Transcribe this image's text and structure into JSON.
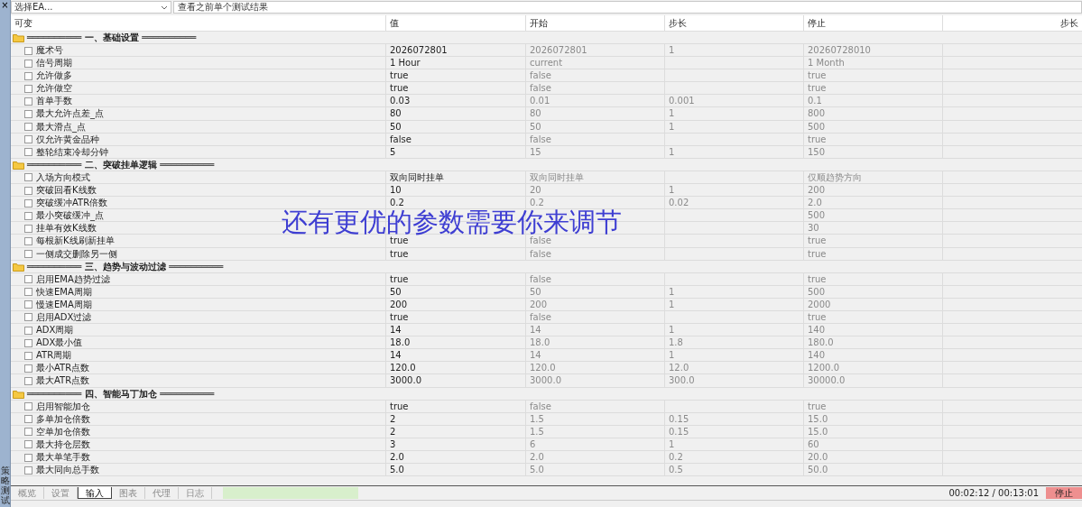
{
  "ea_selector": {
    "value": "选择EA..."
  },
  "history_field": {
    "value": "查看之前单个测试结果"
  },
  "columns": [
    "可变",
    "值",
    "开始",
    "步长",
    "停止",
    "步长"
  ],
  "groups": [
    {
      "title": "══════════ 一、基础设置 ══════════",
      "rows": [
        {
          "name": "魔术号",
          "checked": false,
          "value": "2026072801",
          "start": "2026072801",
          "step": "1",
          "stop": "20260728010"
        },
        {
          "name": "信号周期",
          "checked": false,
          "value": "1 Hour",
          "start": "current",
          "stop": "1 Month"
        },
        {
          "name": "允许做多",
          "checked": false,
          "value": "true",
          "start": "false",
          "stop": "true"
        },
        {
          "name": "允许做空",
          "checked": false,
          "value": "true",
          "start": "false",
          "stop": "true"
        },
        {
          "name": "首单手数",
          "checked": false,
          "value": "0.03",
          "start": "0.01",
          "step": "0.001",
          "stop": "0.1"
        },
        {
          "name": "最大允许点差_点",
          "checked": false,
          "value": "80",
          "start": "80",
          "step": "1",
          "stop": "800"
        },
        {
          "name": "最大滑点_点",
          "checked": false,
          "value": "50",
          "start": "50",
          "step": "1",
          "stop": "500"
        },
        {
          "name": "仅允许黄金品种",
          "checked": false,
          "value": "false",
          "start": "false",
          "stop": "true"
        },
        {
          "name": "整轮结束冷却分钟",
          "checked": false,
          "value": "5",
          "start": "15",
          "step": "1",
          "stop": "150"
        }
      ]
    },
    {
      "title": "══════════ 二、突破挂单逻辑 ══════════",
      "rows": [
        {
          "name": "入场方向模式",
          "checked": false,
          "value": "双向同时挂单",
          "start": "双向同时挂单",
          "stop": "仅顺趋势方向"
        },
        {
          "name": "突破回看K线数",
          "checked": false,
          "value": "10",
          "start": "20",
          "step": "1",
          "stop": "200"
        },
        {
          "name": "突破缓冲ATR倍数",
          "checked": false,
          "value": "0.2",
          "start": "0.2",
          "step": "0.02",
          "stop": "2.0"
        },
        {
          "name": "最小突破缓冲_点",
          "checked": false,
          "stop": "500"
        },
        {
          "name": "挂单有效K线数",
          "checked": false,
          "stop": "30"
        },
        {
          "name": "每根新K线刷新挂单",
          "checked": false,
          "value": "true",
          "start": "false",
          "stop": "true"
        },
        {
          "name": "一侧成交删除另一侧",
          "checked": false,
          "value": "true",
          "start": "false",
          "stop": "true"
        }
      ]
    },
    {
      "title": "══════════ 三、趋势与波动过滤 ══════════",
      "rows": [
        {
          "name": "启用EMA趋势过滤",
          "checked": false,
          "value": "true",
          "start": "false",
          "stop": "true"
        },
        {
          "name": "快速EMA周期",
          "checked": false,
          "value": "50",
          "start": "50",
          "step": "1",
          "stop": "500"
        },
        {
          "name": "慢速EMA周期",
          "checked": false,
          "value": "200",
          "start": "200",
          "step": "1",
          "stop": "2000"
        },
        {
          "name": "启用ADX过滤",
          "checked": false,
          "value": "true",
          "start": "false",
          "stop": "true"
        },
        {
          "name": "ADX周期",
          "checked": false,
          "value": "14",
          "start": "14",
          "step": "1",
          "stop": "140"
        },
        {
          "name": "ADX最小值",
          "checked": false,
          "value": "18.0",
          "start": "18.0",
          "step": "1.8",
          "stop": "180.0"
        },
        {
          "name": "ATR周期",
          "checked": false,
          "value": "14",
          "start": "14",
          "step": "1",
          "stop": "140"
        },
        {
          "name": "最小ATR点数",
          "checked": false,
          "value": "120.0",
          "start": "120.0",
          "step": "12.0",
          "stop": "1200.0"
        },
        {
          "name": "最大ATR点数",
          "checked": false,
          "value": "3000.0",
          "start": "3000.0",
          "step": "300.0",
          "stop": "30000.0"
        }
      ]
    },
    {
      "title": "══════════ 四、智能马丁加仓 ══════════",
      "rows": [
        {
          "name": "启用智能加仓",
          "checked": false,
          "value": "true",
          "start": "false",
          "stop": "true"
        },
        {
          "name": "多单加仓倍数",
          "checked": false,
          "value": "2",
          "start": "1.5",
          "step": "0.15",
          "stop": "15.0"
        },
        {
          "name": "空单加仓倍数",
          "checked": false,
          "value": "2",
          "start": "1.5",
          "step": "0.15",
          "stop": "15.0"
        },
        {
          "name": "最大持仓层数",
          "checked": false,
          "value": "3",
          "start": "6",
          "step": "1",
          "stop": "60"
        },
        {
          "name": "最大单笔手数",
          "checked": false,
          "value": "2.0",
          "start": "2.0",
          "step": "0.2",
          "stop": "20.0"
        },
        {
          "name": "最大同向总手数",
          "checked": false,
          "value": "5.0",
          "start": "5.0",
          "step": "0.5",
          "stop": "50.0"
        }
      ]
    }
  ],
  "close_glyph": "×",
  "caption": "还有更优的参数需要你来调节",
  "tabs": [
    {
      "label": "概览",
      "selected": false
    },
    {
      "label": "设置",
      "selected": false
    },
    {
      "label": "输入",
      "selected": true
    },
    {
      "label": "图表",
      "selected": false
    },
    {
      "label": "代理",
      "selected": false
    },
    {
      "label": "日志",
      "selected": false
    }
  ],
  "timer": "00:02:12 / 00:13:01",
  "stop_button": "停止",
  "side_label": "策略测试"
}
